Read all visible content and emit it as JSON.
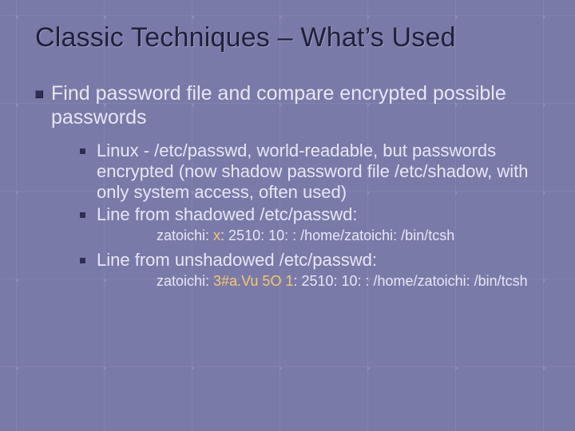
{
  "title": "Classic Techniques – What’s Used",
  "level1": {
    "text": "Find password file and compare encrypted possible passwords"
  },
  "level2": {
    "item0": "Linux - /etc/passwd, world-readable, but passwords encrypted (now shadow password file /etc/shadow, with only system access, often used)",
    "item1": "Line from shadowed /etc/passwd:",
    "item2": "Line from unshadowed /etc/passwd:"
  },
  "code": {
    "shadowed_pre": "zatoichi: ",
    "shadowed_hl": "x",
    "shadowed_post": ": 2510: 10: : /home/zatoichi: /bin/tcsh",
    "unshadowed_pre": "zatoichi: ",
    "unshadowed_hl": "3#a.Vu 5O 1",
    "unshadowed_post": ": 2510: 10: : /home/zatoichi: /bin/tcsh"
  }
}
